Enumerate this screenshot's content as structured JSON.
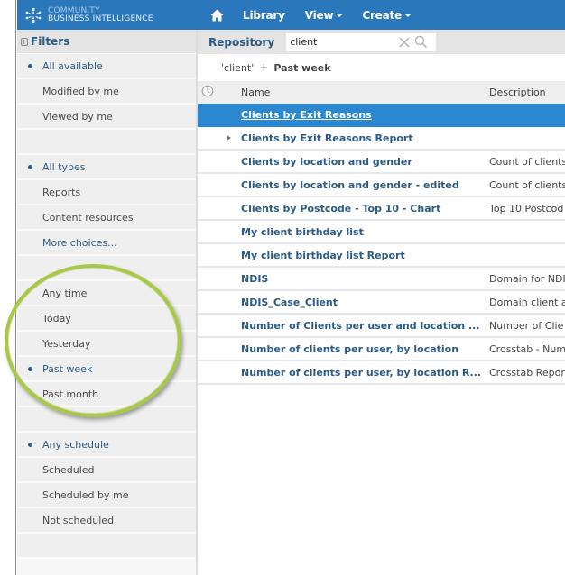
{
  "brand": {
    "line1": "COMMUNITY",
    "line2": "BUSINESS INTELLIGENCE",
    "logo_icon": "starburst-logo-icon"
  },
  "nav": {
    "home_icon": "home-icon",
    "items": [
      {
        "label": "Library",
        "has_menu": false
      },
      {
        "label": "View",
        "has_menu": true
      },
      {
        "label": "Create",
        "has_menu": true
      }
    ]
  },
  "sidebar": {
    "title": "Filters",
    "groups": [
      {
        "items": [
          {
            "label": "All available",
            "selected": true
          },
          {
            "label": "Modified by me",
            "selected": false
          },
          {
            "label": "Viewed by me",
            "selected": false
          }
        ]
      },
      {
        "items": [
          {
            "label": "All types",
            "selected": true
          },
          {
            "label": "Reports",
            "selected": false
          },
          {
            "label": "Content resources",
            "selected": false
          },
          {
            "label": "More choices...",
            "selected": false
          }
        ]
      },
      {
        "items": [
          {
            "label": "Any time",
            "selected": false
          },
          {
            "label": "Today",
            "selected": false
          },
          {
            "label": "Yesterday",
            "selected": false
          },
          {
            "label": "Past week",
            "selected": true
          },
          {
            "label": "Past month",
            "selected": false
          }
        ]
      },
      {
        "items": [
          {
            "label": "Any schedule",
            "selected": true
          },
          {
            "label": "Scheduled",
            "selected": false
          },
          {
            "label": "Scheduled by me",
            "selected": false
          },
          {
            "label": "Not scheduled",
            "selected": false
          }
        ]
      }
    ]
  },
  "repository": {
    "title": "Repository",
    "search_value": "client",
    "search_placeholder": ""
  },
  "breadcrumb": {
    "term": "'client'",
    "plus": "+",
    "filter": "Past week"
  },
  "table": {
    "columns": {
      "name": "Name",
      "description": "Description"
    },
    "rows": [
      {
        "name": "Clients by Exit Reasons",
        "description": "",
        "selected": true,
        "expandable": false
      },
      {
        "name": "Clients by Exit Reasons Report",
        "description": "",
        "selected": false,
        "expandable": true
      },
      {
        "name": "Clients by location and gender",
        "description": "Count of clients",
        "selected": false,
        "expandable": false
      },
      {
        "name": "Clients by location and gender - edited",
        "description": "Count of clients",
        "selected": false,
        "expandable": false
      },
      {
        "name": "Clients by Postcode - Top 10 - Chart",
        "description": "Top 10 Postcod",
        "selected": false,
        "expandable": false
      },
      {
        "name": "My client birthday list",
        "description": "",
        "selected": false,
        "expandable": false
      },
      {
        "name": "My client birthday list Report",
        "description": "",
        "selected": false,
        "expandable": false
      },
      {
        "name": "NDIS",
        "description": "Domain for NDI",
        "selected": false,
        "expandable": false
      },
      {
        "name": "NDIS_Case_Client",
        "description": "Domain client a",
        "selected": false,
        "expandable": false
      },
      {
        "name": "Number of Clients per user and location ...",
        "description": "Number of Clie",
        "selected": false,
        "expandable": false
      },
      {
        "name": "Number of clients per user, by location",
        "description": "Crosstab - Num",
        "selected": false,
        "expandable": false
      },
      {
        "name": "Number of clients per user, by location R...",
        "description": "Crosstab Repor",
        "selected": false,
        "expandable": false
      }
    ]
  },
  "colors": {
    "header_blue": "#2a78bb",
    "selected_row": "#2a87d0",
    "link_text": "#2b5a85",
    "annotation_green": "#a8c84a"
  }
}
